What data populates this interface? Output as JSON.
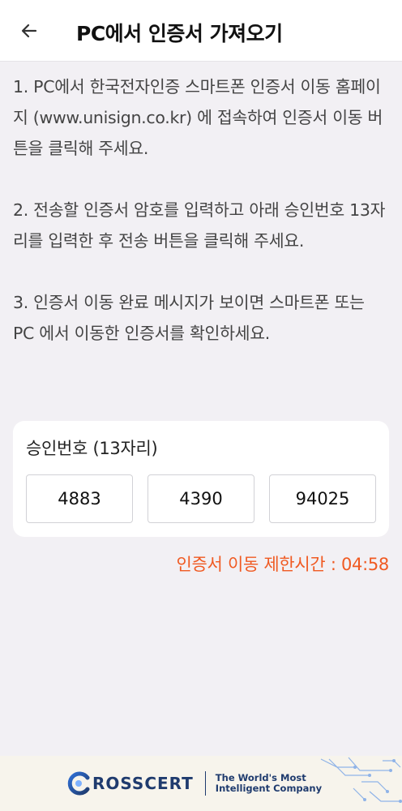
{
  "header": {
    "title": "PC에서 인증서 가져오기",
    "back_icon": "arrow-left-icon"
  },
  "instructions": [
    "1. PC에서 한국전자인증 스마트폰 인증서 이동 홈페이지 (www.unisign.co.kr) 에 접속하여 인증서 이동 버튼을 클릭해 주세요.",
    "2. 전송할 인증서 암호를 입력하고 아래 승인번호 13자리를 입력한 후 전송 버튼을 클릭해 주세요.",
    "3. 인증서 이동 완료 메시지가 보이면 스마트폰 또는 PC 에서 이동한 인증서를 확인하세요."
  ],
  "approval": {
    "label": "승인번호 (13자리)",
    "codes": [
      "4883",
      "4390",
      "94025"
    ]
  },
  "timer": {
    "text": "인증서 이동 제한시간 : 04:58"
  },
  "footer": {
    "brand": "ROSSCERT",
    "tagline_line1": "The World's Most",
    "tagline_line2": "Intelligent Company"
  },
  "colors": {
    "accent": "#f05a22",
    "brand": "#1f3b6e",
    "background": "#f2f0f4"
  }
}
